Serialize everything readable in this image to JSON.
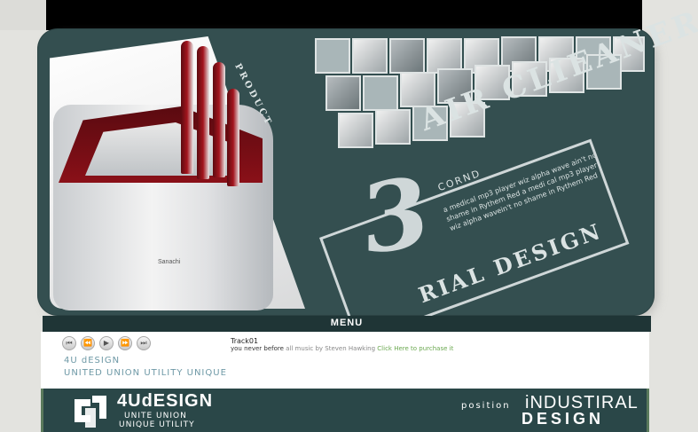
{
  "banner": {
    "product_label": "PRODUCT",
    "brand_on_device": "Sanachi",
    "number": "3",
    "title": "AIR CLIEANER",
    "subtitle": "CORND",
    "description": "a medical mp3 player wiz alpha wave ain't no shame in Rythem Red a medi cal mp3 player wiz alpha wavein't no shame in Rythem Red",
    "bottom_text": "RIAL DESIGN"
  },
  "menu": {
    "label": "MENU"
  },
  "player": {
    "controls": [
      {
        "name": "stop-icon",
        "glyph": "⏮"
      },
      {
        "name": "rewind-icon",
        "glyph": "⏪"
      },
      {
        "name": "play-icon",
        "glyph": "▶"
      },
      {
        "name": "forward-icon",
        "glyph": "⏩"
      },
      {
        "name": "next-icon",
        "glyph": "⏭"
      }
    ],
    "track_name": "Track01",
    "track_title": "you never before",
    "credit": "all music by Steven Hawking",
    "buy_link": "Click Here to purchase it"
  },
  "brand": {
    "name": "4U dESIGN",
    "tagline": "UNITED UNION UTILITY UNIQUE"
  },
  "footer": {
    "logo_text": "4UdESIGN",
    "logo_sub1": "UNITE UNION",
    "logo_sub2": "UNIQUE UTILITY",
    "position": "position",
    "industrial": "iNDUSTIRAL",
    "design": "DESIGN"
  },
  "colors": {
    "panel": "#344f50",
    "footer": "#2a4748",
    "accent_red": "#8a1018",
    "link_green": "#6aa84f",
    "brand_blue": "#6e99a6"
  }
}
